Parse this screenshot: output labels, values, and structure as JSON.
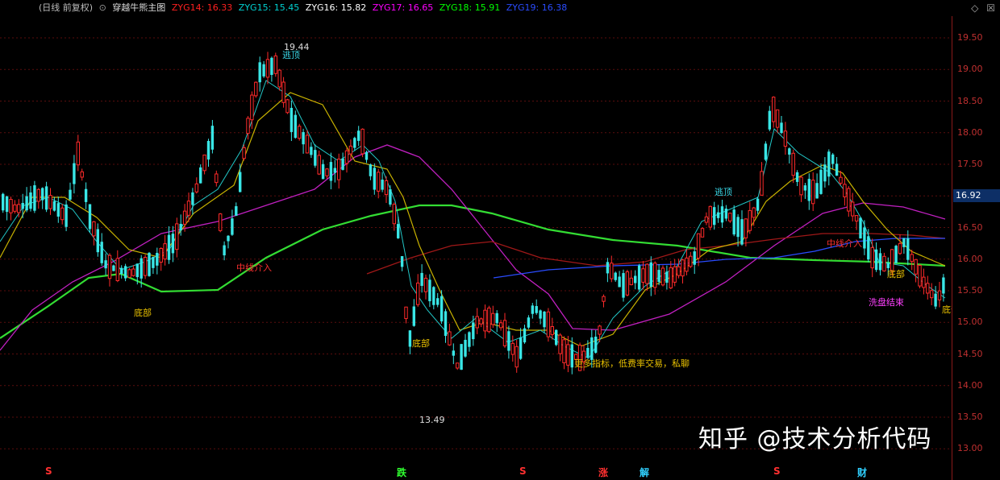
{
  "header": {
    "period_label": "(日线 前复权)",
    "indicator_title": "穿越牛熊主图",
    "zyg": [
      {
        "label": "ZYG14: 16.33",
        "color": "#ff2020"
      },
      {
        "label": "ZYG15: 15.45",
        "color": "#00d0d0"
      },
      {
        "label": "ZYG16: 15.82",
        "color": "#ffffff"
      },
      {
        "label": "ZYG17: 16.65",
        "color": "#ff00ff"
      },
      {
        "label": "ZYG18: 15.91",
        "color": "#00ff00"
      },
      {
        "label": "ZYG19: 16.38",
        "color": "#2a4cff"
      }
    ],
    "corner_icons": [
      "diamond-icon",
      "close-icon"
    ]
  },
  "axis": {
    "ticks": [
      "19.50",
      "19.00",
      "18.50",
      "18.00",
      "17.50",
      "17.00",
      "16.50",
      "16.00",
      "15.50",
      "15.00",
      "14.50",
      "14.00",
      "13.50",
      "13.00"
    ],
    "current_price": "16.92"
  },
  "annotations": {
    "high": "19.44",
    "low": "13.49",
    "escape_top_1": "逃顶",
    "escape_top_2": "逃顶",
    "bottom_1": "底部",
    "bottom_2": "底部",
    "bottom_3": "底部",
    "bottom_4": "底部",
    "mid_entry_1": "中线介入",
    "mid_entry_2": "中线介入",
    "wash_end": "洗盘结束",
    "promo": "更多指标，低费率交易，私聊"
  },
  "signals": [
    {
      "text": "S",
      "color": "#ff3030"
    },
    {
      "text": "跌",
      "color": "#30ff30"
    },
    {
      "text": "S",
      "color": "#ff3030"
    },
    {
      "text": "涨",
      "color": "#ff3030"
    },
    {
      "text": "解",
      "color": "#30d0ff"
    },
    {
      "text": "S",
      "color": "#ff3030"
    },
    {
      "text": "财",
      "color": "#30d0ff"
    }
  ],
  "watermark": "知乎 @技术分析代码",
  "colors": {
    "up": "#ff2a2a",
    "down": "#39e6e6",
    "grid": "#5a0d0d",
    "axis": "#c03030"
  }
}
